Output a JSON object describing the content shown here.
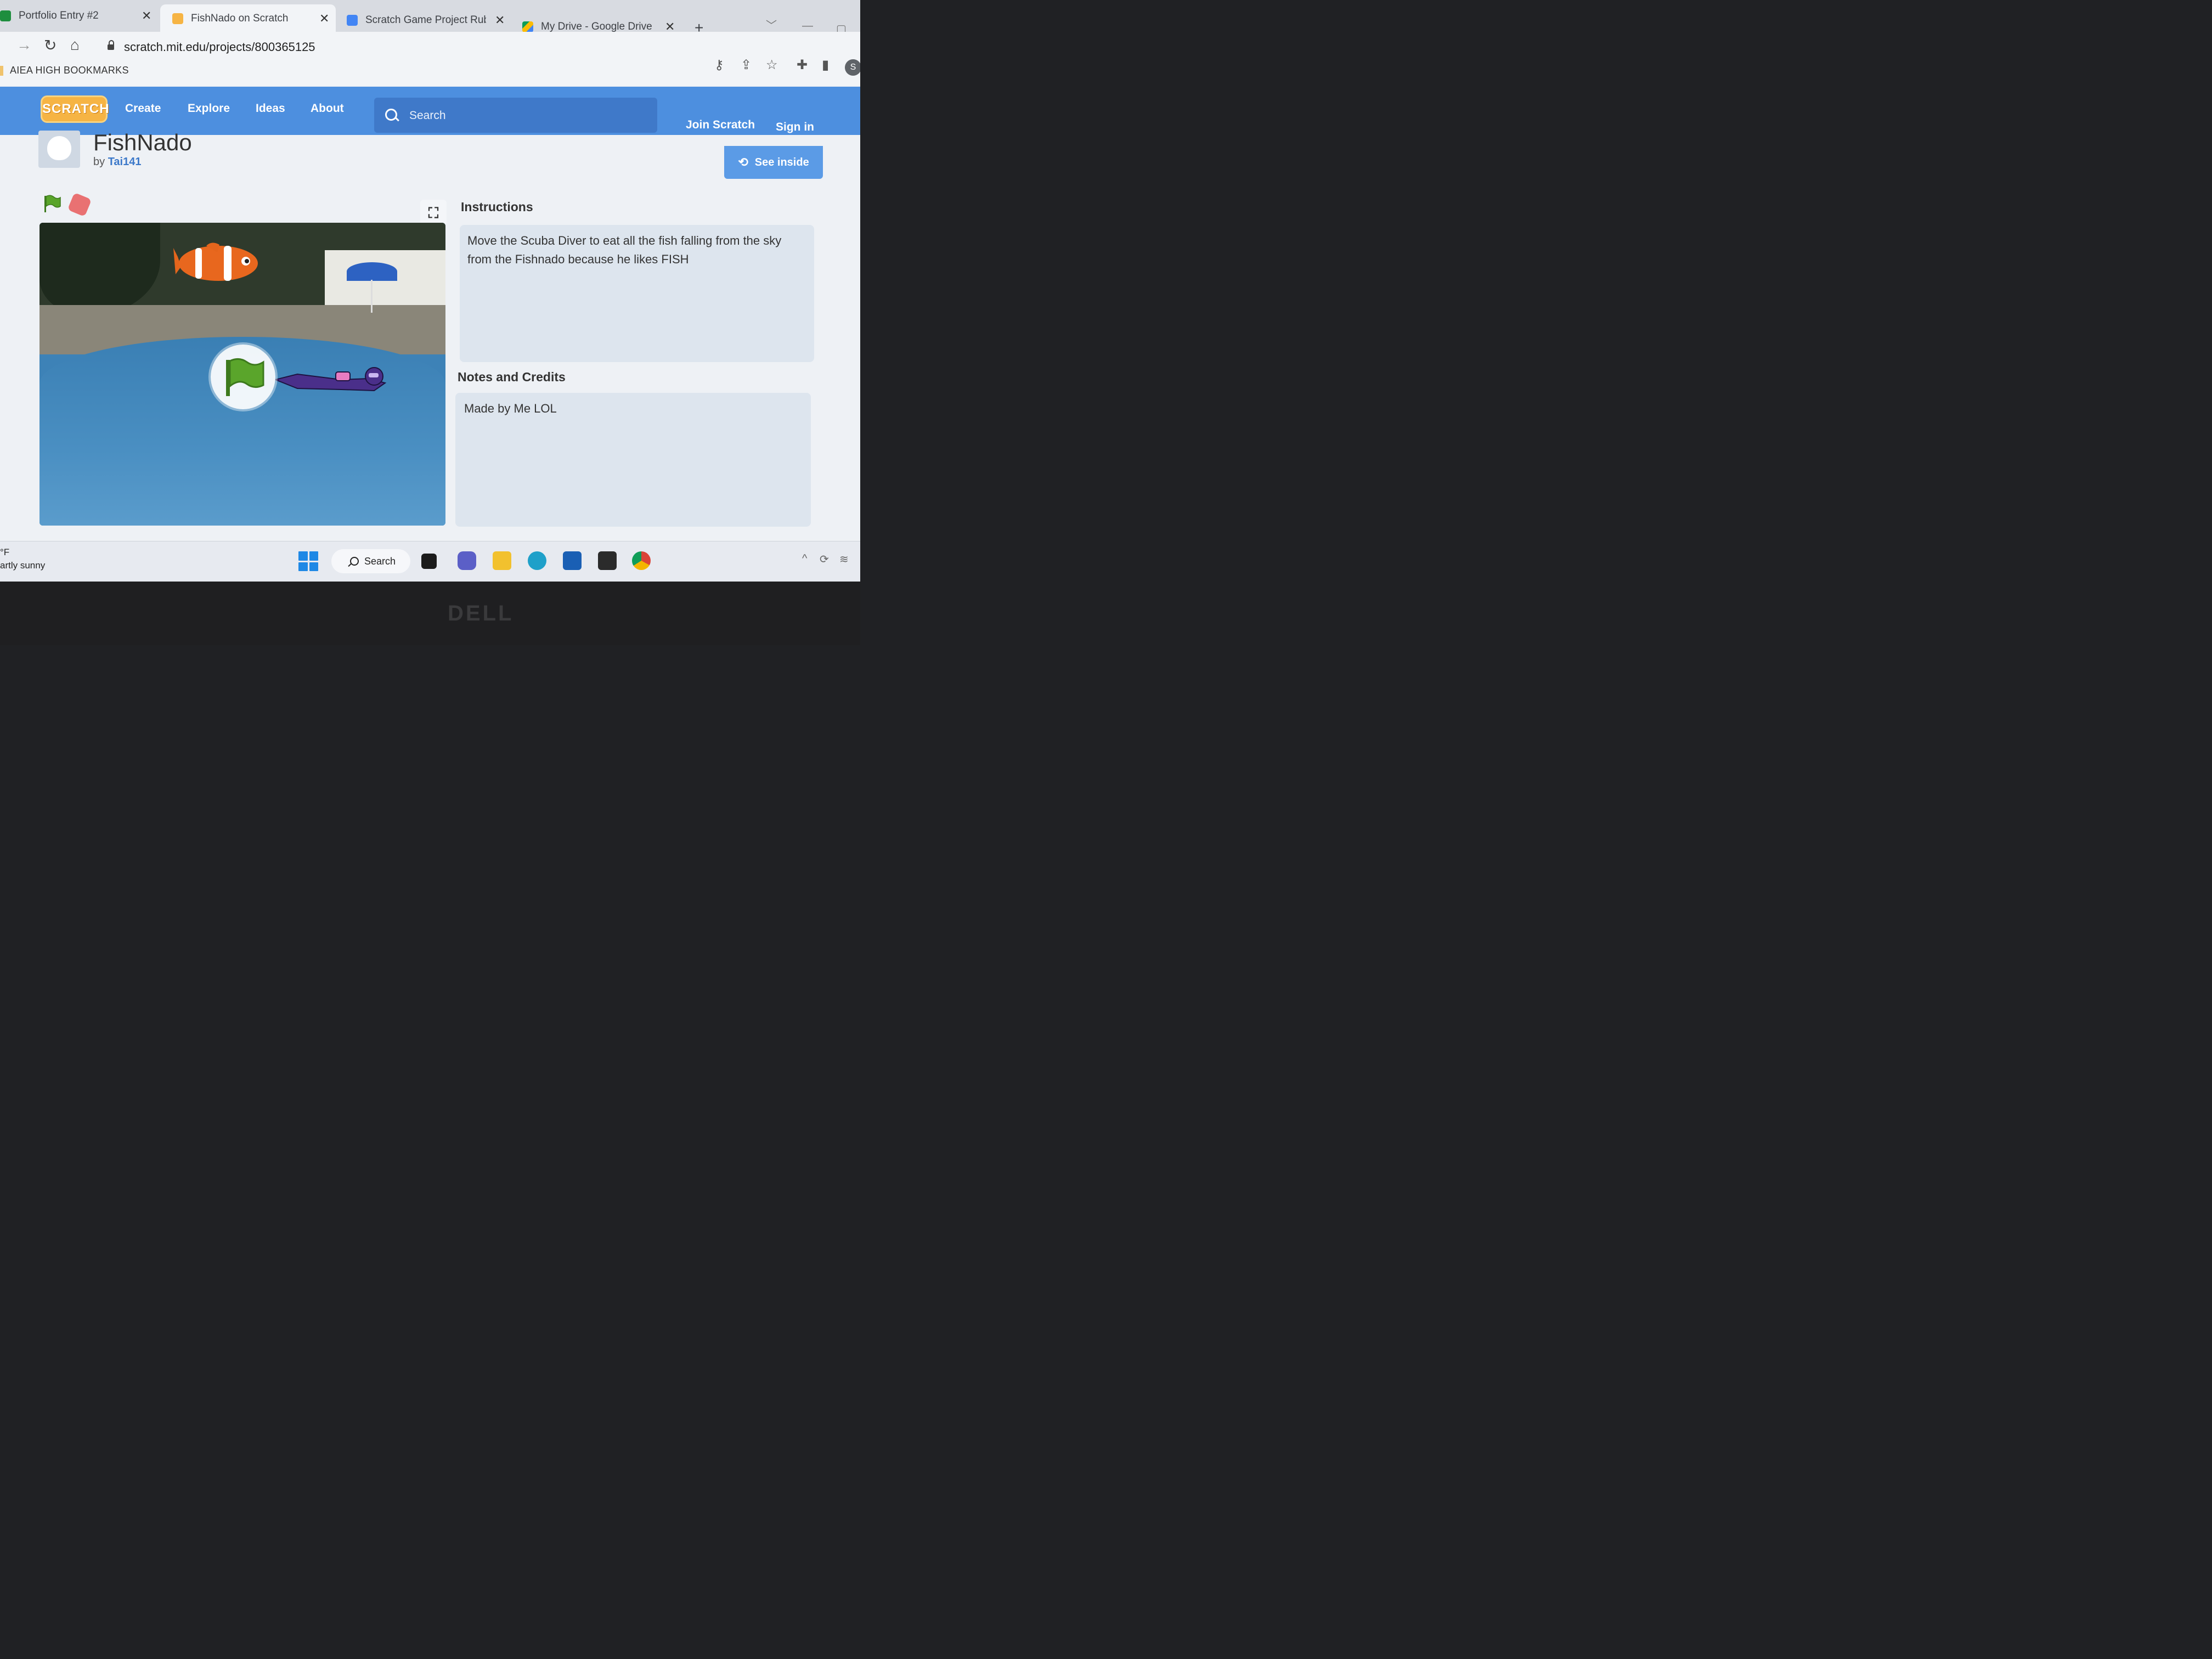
{
  "browser": {
    "tabs": [
      {
        "title": "Portfolio Entry #2",
        "active": false
      },
      {
        "title": "FishNado on Scratch",
        "active": true
      },
      {
        "title": "Scratch Game Project Rubr",
        "active": false
      },
      {
        "title": "My Drive - Google Drive",
        "active": false
      }
    ],
    "new_tab": "+",
    "url": "scratch.mit.edu/projects/800365125",
    "bookmark_folder": "AIEA HIGH BOOKMARKS",
    "profile_initial": "S"
  },
  "scratch_nav": {
    "logo": "SCRATCH",
    "links": [
      "Create",
      "Explore",
      "Ideas",
      "About"
    ],
    "search_placeholder": "Search",
    "join": "Join Scratch",
    "signin": "Sign in"
  },
  "project": {
    "title": "FishNado",
    "by": "by",
    "author": "Tai141",
    "see_inside": "See inside",
    "instructions_title": "Instructions",
    "instructions": "Move the Scuba Diver to eat all the fish falling from the sky from the Fishnado because he likes FISH",
    "notes_title": "Notes and Credits",
    "notes": "Made by Me LOL"
  },
  "taskbar": {
    "weather_temp": "°F",
    "weather_desc": "artly sunny",
    "search_label": "Search"
  },
  "bezel_brand": "DELL",
  "colors": {
    "scratch_blue": "#4d8fdf",
    "scratch_orange": "#f6b444",
    "green_flag": "#5aa52b",
    "stop": "#e85a5a"
  }
}
